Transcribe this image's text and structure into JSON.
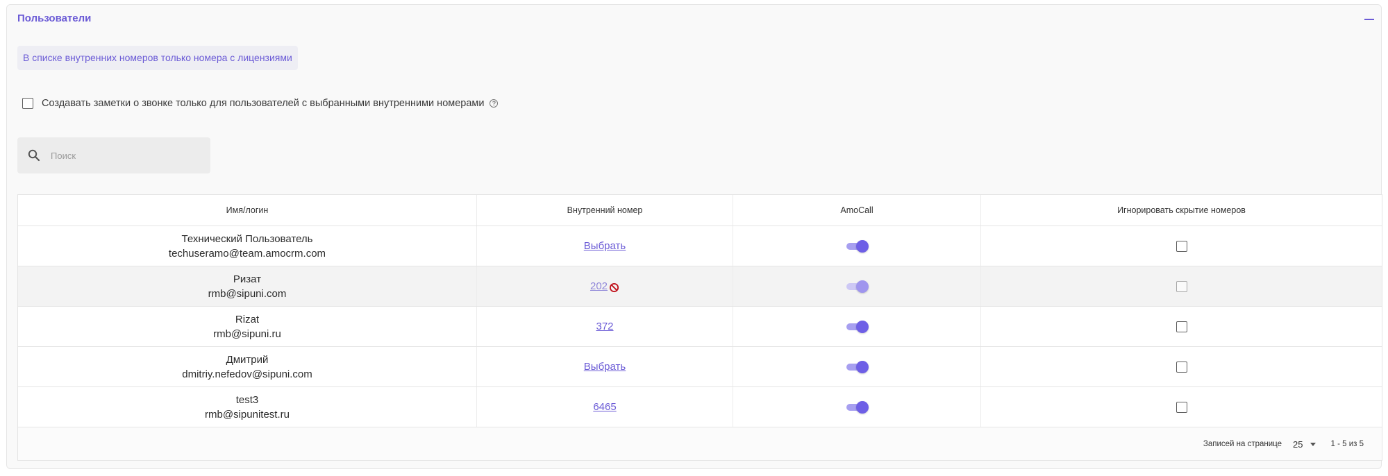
{
  "panel": {
    "title": "Пользователи",
    "info_chip": "В списке внутренних номеров только номера с лицензиями",
    "notes_checkbox_label": "Создавать заметки о звонке только для пользователей с выбранными внутренними номерами"
  },
  "search": {
    "placeholder": "Поиск",
    "value": ""
  },
  "table": {
    "headers": [
      "Имя/логин",
      "Внутренний номер",
      "AmoCall",
      "Игнорировать скрытие номеров"
    ],
    "rows": [
      {
        "name": "Технический Пользователь",
        "email": "techuseramo@team.amocrm.com",
        "extension": "Выбрать",
        "extension_blocked": false,
        "amocall_enabled": true,
        "ignore_hidden_checked": false,
        "disabled": false
      },
      {
        "name": "Ризат",
        "email": "rmb@sipuni.com",
        "extension": "202",
        "extension_blocked": true,
        "amocall_enabled": true,
        "ignore_hidden_checked": false,
        "disabled": true
      },
      {
        "name": "Rizat",
        "email": "rmb@sipuni.ru",
        "extension": "372",
        "extension_blocked": false,
        "amocall_enabled": true,
        "ignore_hidden_checked": false,
        "disabled": false
      },
      {
        "name": "Дмитрий",
        "email": "dmitriy.nefedov@sipuni.com",
        "extension": "Выбрать",
        "extension_blocked": false,
        "amocall_enabled": true,
        "ignore_hidden_checked": false,
        "disabled": false
      },
      {
        "name": "test3",
        "email": "rmb@sipunitest.ru",
        "extension": "6465",
        "extension_blocked": false,
        "amocall_enabled": true,
        "ignore_hidden_checked": false,
        "disabled": false
      }
    ]
  },
  "pagination": {
    "per_page_label": "Записей на странице",
    "per_page_value": "25",
    "range": "1 - 5 из 5"
  },
  "colors": {
    "accent": "#6b5bd6",
    "blocked": "#c0121c"
  }
}
